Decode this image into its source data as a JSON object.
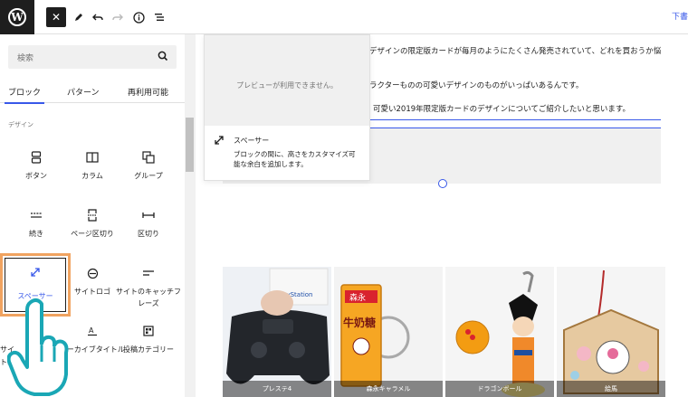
{
  "topbar": {
    "logo_text": "W",
    "right_link": "下書"
  },
  "sidebar": {
    "search_placeholder": "検索",
    "tabs": [
      {
        "label": "ブロック",
        "active": true
      },
      {
        "label": "パターン",
        "active": false
      },
      {
        "label": "再利用可能",
        "active": false
      }
    ],
    "category_label": "デザイン",
    "blocks": [
      {
        "label": "ボタン",
        "icon": "buttons-icon"
      },
      {
        "label": "カラム",
        "icon": "columns-icon"
      },
      {
        "label": "グループ",
        "icon": "group-icon"
      },
      {
        "label": "続き",
        "icon": "more-icon"
      },
      {
        "label": "ページ区切り",
        "icon": "page-break-icon"
      },
      {
        "label": "区切り",
        "icon": "separator-icon"
      },
      {
        "label": "スペーサー",
        "icon": "spacer-icon",
        "highlighted": true
      },
      {
        "label": "サイトロゴ",
        "icon": "site-logo-icon"
      },
      {
        "label": "サイトのキャッチフレーズ",
        "icon": "tagline-icon"
      },
      {
        "label": "サイ",
        "icon": "site-title-icon"
      },
      {
        "label": "アーカイブタイトル",
        "icon": "archive-title-icon"
      },
      {
        "label": "投稿カテゴリー",
        "icon": "post-categories-icon"
      }
    ],
    "partial_label": "トル"
  },
  "preview": {
    "unavailable": "プレビューが利用できません。",
    "title": "スペーサー",
    "description": "ブロックの間に、高さをカスタマイズ可能な余白を追加します。"
  },
  "content": {
    "line1": "デザインの限定版カードが毎月のようにたくさん発売されていて、どれを買おうか悩",
    "line2": "ラクターものの可愛いデザインのものがいっぱいあるんです。",
    "line3": "可愛い2019年限定版カードのデザインについてご紹介したいと思います。"
  },
  "products": [
    {
      "caption": "プレステ4"
    },
    {
      "caption": "森永キャラメル"
    },
    {
      "caption": "ドラゴンボール"
    },
    {
      "caption": "絵馬"
    }
  ],
  "product_texts": {
    "ps_label": "PlayStation",
    "caramel_top": "森永",
    "caramel_main": "牛奶糖"
  },
  "colors": {
    "accent": "#3858e9",
    "highlight_border": "#f0a360",
    "hand": "#1aa7b5"
  }
}
